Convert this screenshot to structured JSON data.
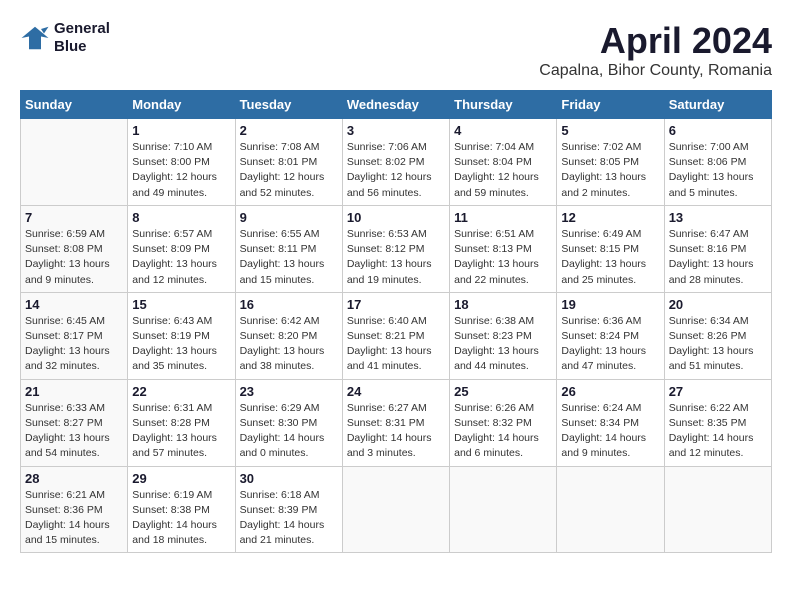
{
  "logo": {
    "line1": "General",
    "line2": "Blue"
  },
  "title": "April 2024",
  "subtitle": "Capalna, Bihor County, Romania",
  "days_of_week": [
    "Sunday",
    "Monday",
    "Tuesday",
    "Wednesday",
    "Thursday",
    "Friday",
    "Saturday"
  ],
  "weeks": [
    [
      {
        "num": "",
        "sunrise": "",
        "sunset": "",
        "daylight": ""
      },
      {
        "num": "1",
        "sunrise": "Sunrise: 7:10 AM",
        "sunset": "Sunset: 8:00 PM",
        "daylight": "Daylight: 12 hours and 49 minutes."
      },
      {
        "num": "2",
        "sunrise": "Sunrise: 7:08 AM",
        "sunset": "Sunset: 8:01 PM",
        "daylight": "Daylight: 12 hours and 52 minutes."
      },
      {
        "num": "3",
        "sunrise": "Sunrise: 7:06 AM",
        "sunset": "Sunset: 8:02 PM",
        "daylight": "Daylight: 12 hours and 56 minutes."
      },
      {
        "num": "4",
        "sunrise": "Sunrise: 7:04 AM",
        "sunset": "Sunset: 8:04 PM",
        "daylight": "Daylight: 12 hours and 59 minutes."
      },
      {
        "num": "5",
        "sunrise": "Sunrise: 7:02 AM",
        "sunset": "Sunset: 8:05 PM",
        "daylight": "Daylight: 13 hours and 2 minutes."
      },
      {
        "num": "6",
        "sunrise": "Sunrise: 7:00 AM",
        "sunset": "Sunset: 8:06 PM",
        "daylight": "Daylight: 13 hours and 5 minutes."
      }
    ],
    [
      {
        "num": "7",
        "sunrise": "Sunrise: 6:59 AM",
        "sunset": "Sunset: 8:08 PM",
        "daylight": "Daylight: 13 hours and 9 minutes."
      },
      {
        "num": "8",
        "sunrise": "Sunrise: 6:57 AM",
        "sunset": "Sunset: 8:09 PM",
        "daylight": "Daylight: 13 hours and 12 minutes."
      },
      {
        "num": "9",
        "sunrise": "Sunrise: 6:55 AM",
        "sunset": "Sunset: 8:11 PM",
        "daylight": "Daylight: 13 hours and 15 minutes."
      },
      {
        "num": "10",
        "sunrise": "Sunrise: 6:53 AM",
        "sunset": "Sunset: 8:12 PM",
        "daylight": "Daylight: 13 hours and 19 minutes."
      },
      {
        "num": "11",
        "sunrise": "Sunrise: 6:51 AM",
        "sunset": "Sunset: 8:13 PM",
        "daylight": "Daylight: 13 hours and 22 minutes."
      },
      {
        "num": "12",
        "sunrise": "Sunrise: 6:49 AM",
        "sunset": "Sunset: 8:15 PM",
        "daylight": "Daylight: 13 hours and 25 minutes."
      },
      {
        "num": "13",
        "sunrise": "Sunrise: 6:47 AM",
        "sunset": "Sunset: 8:16 PM",
        "daylight": "Daylight: 13 hours and 28 minutes."
      }
    ],
    [
      {
        "num": "14",
        "sunrise": "Sunrise: 6:45 AM",
        "sunset": "Sunset: 8:17 PM",
        "daylight": "Daylight: 13 hours and 32 minutes."
      },
      {
        "num": "15",
        "sunrise": "Sunrise: 6:43 AM",
        "sunset": "Sunset: 8:19 PM",
        "daylight": "Daylight: 13 hours and 35 minutes."
      },
      {
        "num": "16",
        "sunrise": "Sunrise: 6:42 AM",
        "sunset": "Sunset: 8:20 PM",
        "daylight": "Daylight: 13 hours and 38 minutes."
      },
      {
        "num": "17",
        "sunrise": "Sunrise: 6:40 AM",
        "sunset": "Sunset: 8:21 PM",
        "daylight": "Daylight: 13 hours and 41 minutes."
      },
      {
        "num": "18",
        "sunrise": "Sunrise: 6:38 AM",
        "sunset": "Sunset: 8:23 PM",
        "daylight": "Daylight: 13 hours and 44 minutes."
      },
      {
        "num": "19",
        "sunrise": "Sunrise: 6:36 AM",
        "sunset": "Sunset: 8:24 PM",
        "daylight": "Daylight: 13 hours and 47 minutes."
      },
      {
        "num": "20",
        "sunrise": "Sunrise: 6:34 AM",
        "sunset": "Sunset: 8:26 PM",
        "daylight": "Daylight: 13 hours and 51 minutes."
      }
    ],
    [
      {
        "num": "21",
        "sunrise": "Sunrise: 6:33 AM",
        "sunset": "Sunset: 8:27 PM",
        "daylight": "Daylight: 13 hours and 54 minutes."
      },
      {
        "num": "22",
        "sunrise": "Sunrise: 6:31 AM",
        "sunset": "Sunset: 8:28 PM",
        "daylight": "Daylight: 13 hours and 57 minutes."
      },
      {
        "num": "23",
        "sunrise": "Sunrise: 6:29 AM",
        "sunset": "Sunset: 8:30 PM",
        "daylight": "Daylight: 14 hours and 0 minutes."
      },
      {
        "num": "24",
        "sunrise": "Sunrise: 6:27 AM",
        "sunset": "Sunset: 8:31 PM",
        "daylight": "Daylight: 14 hours and 3 minutes."
      },
      {
        "num": "25",
        "sunrise": "Sunrise: 6:26 AM",
        "sunset": "Sunset: 8:32 PM",
        "daylight": "Daylight: 14 hours and 6 minutes."
      },
      {
        "num": "26",
        "sunrise": "Sunrise: 6:24 AM",
        "sunset": "Sunset: 8:34 PM",
        "daylight": "Daylight: 14 hours and 9 minutes."
      },
      {
        "num": "27",
        "sunrise": "Sunrise: 6:22 AM",
        "sunset": "Sunset: 8:35 PM",
        "daylight": "Daylight: 14 hours and 12 minutes."
      }
    ],
    [
      {
        "num": "28",
        "sunrise": "Sunrise: 6:21 AM",
        "sunset": "Sunset: 8:36 PM",
        "daylight": "Daylight: 14 hours and 15 minutes."
      },
      {
        "num": "29",
        "sunrise": "Sunrise: 6:19 AM",
        "sunset": "Sunset: 8:38 PM",
        "daylight": "Daylight: 14 hours and 18 minutes."
      },
      {
        "num": "30",
        "sunrise": "Sunrise: 6:18 AM",
        "sunset": "Sunset: 8:39 PM",
        "daylight": "Daylight: 14 hours and 21 minutes."
      },
      {
        "num": "",
        "sunrise": "",
        "sunset": "",
        "daylight": ""
      },
      {
        "num": "",
        "sunrise": "",
        "sunset": "",
        "daylight": ""
      },
      {
        "num": "",
        "sunrise": "",
        "sunset": "",
        "daylight": ""
      },
      {
        "num": "",
        "sunrise": "",
        "sunset": "",
        "daylight": ""
      }
    ]
  ]
}
